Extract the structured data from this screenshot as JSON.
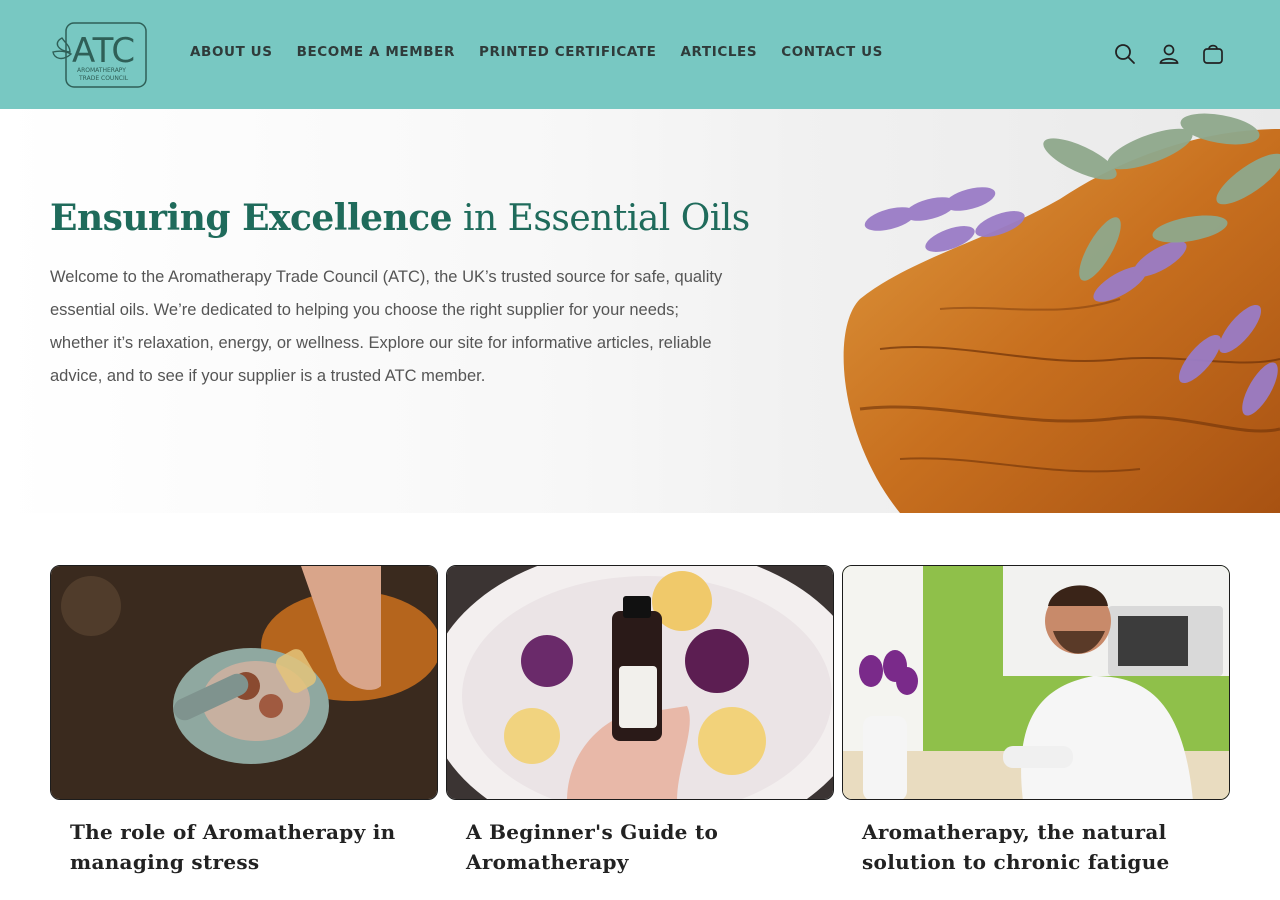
{
  "header": {
    "logo": {
      "text": "ATC",
      "subtext": "AROMATHERAPY TRADE COUNCIL",
      "icon": "leaf-icon"
    },
    "nav": [
      {
        "label": "ABOUT US"
      },
      {
        "label": "BECOME A MEMBER"
      },
      {
        "label": "PRINTED CERTIFICATE"
      },
      {
        "label": "ARTICLES"
      },
      {
        "label": "CONTACT US"
      }
    ],
    "icons": [
      "search-icon",
      "account-icon",
      "cart-icon"
    ]
  },
  "hero": {
    "title_bold": "Ensuring Excellence",
    "title_light": " in Essential Oils",
    "body": "Welcome to the Aromatherapy Trade Council (ATC), the UK’s trusted source for safe, quality essential oils. We’re dedicated to helping you choose the right supplier for your needs; whether it’s relaxation, energy, or wellness. Explore our site for informative articles, reliable advice, and to see if your supplier is a trusted ATC member."
  },
  "articles": [
    {
      "title": "The role of Aromatherapy in managing stress"
    },
    {
      "title": "A Beginner's Guide to Aromatherapy"
    },
    {
      "title": "Aromatherapy, the natural solution to chronic fatigue"
    }
  ],
  "colors": {
    "brand": "#78c8c2",
    "heading": "#1f6b5b",
    "nav_text": "#2f3b3a"
  }
}
